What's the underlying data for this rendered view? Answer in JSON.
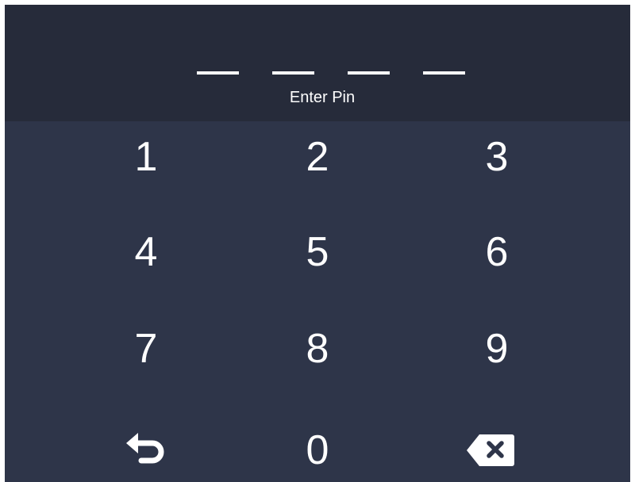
{
  "pin": {
    "label": "Enter Pin",
    "length": 4
  },
  "keypad": {
    "keys": [
      "1",
      "2",
      "3",
      "4",
      "5",
      "6",
      "7",
      "8",
      "9",
      "0"
    ],
    "back_icon": "undo-arrow-icon",
    "delete_icon": "backspace-icon"
  },
  "colors": {
    "header_bg": "#262b3a",
    "keypad_bg": "#2e3549",
    "text": "#ffffff"
  }
}
